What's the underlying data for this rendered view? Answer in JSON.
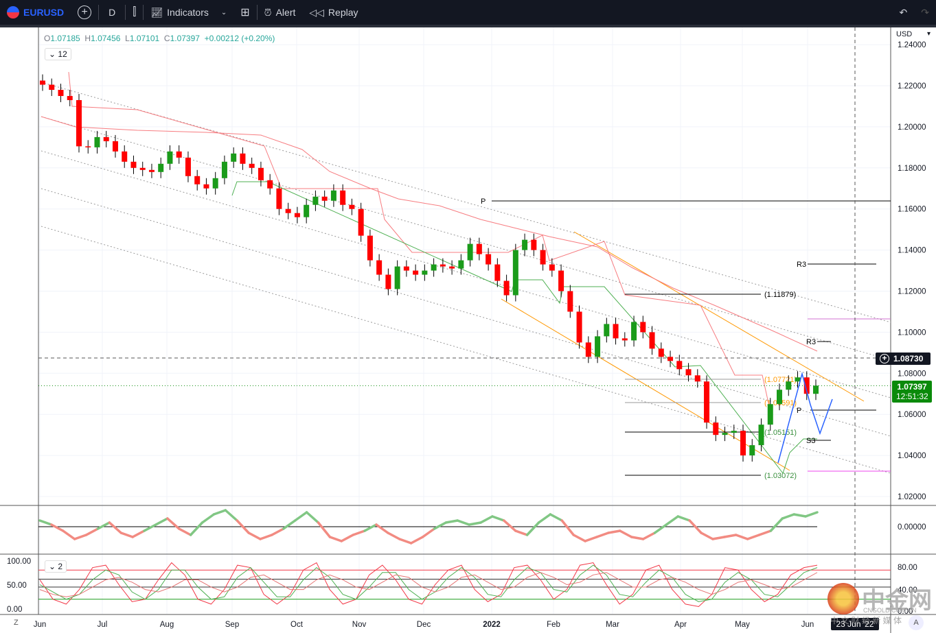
{
  "toolbar": {
    "symbol": "EURUSD",
    "interval": "D",
    "indicators": "Indicators",
    "alert": "Alert",
    "replay": "Replay"
  },
  "legend": {
    "o_label": "O",
    "o": "1.07185",
    "h_label": "H",
    "h": "1.07456",
    "l_label": "L",
    "l": "1.07101",
    "c_label": "C",
    "c": "1.07397",
    "change": "+0.00212 (+0.20%)",
    "collapse_count": "12",
    "osc_count": "2"
  },
  "price_axis": {
    "currency": "USD",
    "ticks": [
      "1.24000",
      "1.22000",
      "1.20000",
      "1.18000",
      "1.16000",
      "1.14000",
      "1.12000",
      "1.10000",
      "1.08000",
      "1.06000",
      "1.04000",
      "1.02000"
    ],
    "crosshair_price": "1.08730",
    "last_price": "1.07397",
    "countdown": "12:51:32"
  },
  "osc_axis": {
    "ticks": [
      "0.00000"
    ]
  },
  "stoch_axis": {
    "right_ticks": [
      "80.00",
      "40.00",
      "0.00"
    ],
    "left_ticks": [
      "100.00",
      "50.00",
      "0.00"
    ]
  },
  "time_axis": {
    "labels": [
      "Jun",
      "Jul",
      "Aug",
      "Sep",
      "Oct",
      "Nov",
      "Dec",
      "2022",
      "Feb",
      "Mar",
      "Apr",
      "May",
      "Jun"
    ],
    "crosshair_date": "23 Jun '22",
    "left_btn": "Z",
    "right_btn": "A"
  },
  "annotations": {
    "p1": "P",
    "r3a": "R3",
    "r3b": "R3",
    "lvl1": "(1.11879)",
    "lvl2": "(1.07721)",
    "lvl3": "(1.06591)",
    "lvl4": "(1.05151)",
    "lvl5": "(1.03072)",
    "s3": "S3",
    "p2": "P"
  },
  "watermark": {
    "text": "中金网",
    "sub": "CNGOLD.COM.CN",
    "tag": "中 文 财 经 新 媒 体"
  },
  "colors": {
    "up": "#089981",
    "down": "#f23645",
    "up_candle": "#1a9b1a",
    "down_candle": "#ff0000",
    "accent": "#2962ff",
    "channel": "#ff9800",
    "ma": "#f77c80"
  },
  "chart_data": {
    "type": "candlestick",
    "ylim": [
      1.01,
      1.245
    ],
    "closes": [
      1.2205,
      1.218,
      1.215,
      1.213,
      1.1905,
      1.19,
      1.195,
      1.193,
      1.188,
      1.183,
      1.18,
      1.179,
      1.178,
      1.182,
      1.188,
      1.185,
      1.176,
      1.172,
      1.17,
      1.175,
      1.183,
      1.187,
      1.182,
      1.18,
      1.174,
      1.17,
      1.16,
      1.158,
      1.156,
      1.162,
      1.166,
      1.164,
      1.169,
      1.162,
      1.16,
      1.147,
      1.135,
      1.128,
      1.121,
      1.132,
      1.13,
      1.128,
      1.13,
      1.133,
      1.132,
      1.131,
      1.135,
      1.143,
      1.138,
      1.133,
      1.125,
      1.118,
      1.14,
      1.145,
      1.14,
      1.133,
      1.13,
      1.12,
      1.11,
      1.095,
      1.088,
      1.098,
      1.104,
      1.097,
      1.096,
      1.105,
      1.1,
      1.092,
      1.088,
      1.086,
      1.082,
      1.079,
      1.076,
      1.056,
      1.05,
      1.051,
      1.052,
      1.04,
      1.045,
      1.055,
      1.065,
      1.072,
      1.076,
      1.078,
      1.07,
      1.074
    ],
    "oscillator": [
      0.3,
      0.1,
      -0.2,
      -0.6,
      -0.4,
      -0.1,
      0.2,
      -0.3,
      -0.5,
      -0.2,
      0.1,
      0.4,
      -0.1,
      -0.4,
      0.2,
      0.6,
      0.8,
      0.3,
      -0.3,
      -0.6,
      -0.4,
      -0.1,
      0.3,
      0.7,
      0.2,
      -0.5,
      -0.7,
      -0.4,
      -0.2,
      0.1,
      -0.3,
      -0.6,
      -0.8,
      -0.5,
      -0.1,
      0.2,
      0.3,
      0.1,
      0.2,
      0.5,
      0.3,
      -0.2,
      -0.4,
      0.2,
      0.6,
      0.3,
      -0.4,
      -0.7,
      -0.5,
      -0.3,
      -0.2,
      -0.5,
      -0.6,
      -0.3,
      0.1,
      0.5,
      0.3,
      -0.3,
      -0.6,
      -0.5,
      -0.4,
      -0.6,
      -0.4,
      -0.2,
      0.4,
      0.6,
      0.5,
      0.7
    ],
    "stoch_k": [
      60,
      20,
      10,
      40,
      85,
      90,
      50,
      15,
      20,
      60,
      95,
      70,
      20,
      10,
      40,
      90,
      85,
      30,
      10,
      30,
      80,
      95,
      40,
      10,
      20,
      70,
      90,
      60,
      20,
      10,
      50,
      80,
      90,
      40,
      15,
      30,
      85,
      90,
      60,
      20,
      40,
      90,
      95,
      50,
      10,
      30,
      80,
      90,
      40,
      10,
      5,
      30,
      85,
      80,
      40,
      15,
      30,
      70,
      85,
      90
    ],
    "stoch_d": [
      50,
      35,
      20,
      30,
      60,
      80,
      70,
      35,
      20,
      40,
      80,
      80,
      45,
      20,
      25,
      65,
      85,
      55,
      25,
      25,
      60,
      85,
      65,
      30,
      20,
      45,
      75,
      75,
      40,
      20,
      35,
      65,
      85,
      65,
      30,
      25,
      60,
      85,
      75,
      40,
      35,
      70,
      90,
      70,
      30,
      25,
      55,
      80,
      65,
      30,
      15,
      20,
      55,
      75,
      60,
      30,
      25,
      50,
      75,
      85
    ],
    "stoch_slow": [
      40,
      30,
      25,
      30,
      45,
      60,
      65,
      55,
      40,
      35,
      45,
      60,
      60,
      45,
      35,
      45,
      65,
      70,
      55,
      40,
      40,
      60,
      70,
      60,
      45,
      40,
      55,
      70,
      65,
      45,
      35,
      45,
      65,
      70,
      55,
      40,
      45,
      65,
      75,
      65,
      50,
      55,
      70,
      75,
      60,
      45,
      45,
      60,
      65,
      55,
      40,
      30,
      40,
      55,
      60,
      50,
      40,
      45,
      60,
      75
    ]
  }
}
